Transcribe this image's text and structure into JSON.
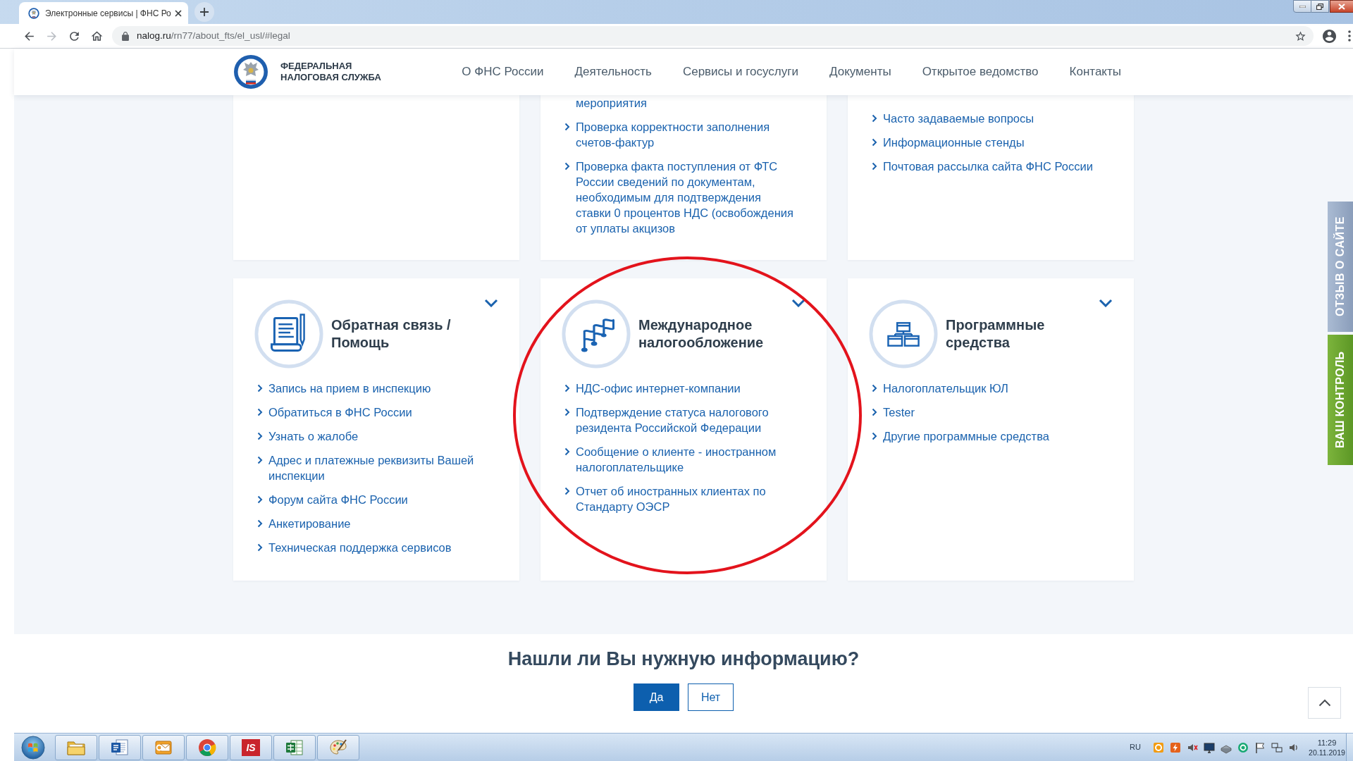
{
  "browser": {
    "tab_title": "Электронные сервисы | ФНС Ро",
    "nav_buttons": [
      {
        "kind": "back",
        "disabled": false
      },
      {
        "kind": "forward",
        "disabled": true
      },
      {
        "kind": "reload",
        "disabled": false
      },
      {
        "kind": "home",
        "disabled": false
      }
    ],
    "url": {
      "host": "nalog.ru",
      "path": "/rn77/about_fts/el_usl/#legal"
    }
  },
  "header": {
    "logo_lines": [
      "ФЕДЕРАЛЬНАЯ",
      "НАЛОГОВАЯ СЛУЖБА"
    ],
    "nav": [
      "О ФНС России",
      "Деятельность",
      "Сервисы и госуслуги",
      "Документы",
      "Открытое ведомство",
      "Контакты"
    ]
  },
  "top_cards": [
    {
      "items": [
        {
          "kind": "continuation",
          "text": "мероприятия"
        },
        {
          "kind": "link",
          "text": "Проверка корректности заполнения счетов-фактур"
        },
        {
          "kind": "link",
          "text": "Проверка факта поступления от ФТС России сведений по документам, необходимым для подтверждения ставки 0 процентов НДС (освобождения от уплаты акцизов"
        }
      ]
    },
    {
      "items": [
        {
          "kind": "link",
          "text": "Часто задаваемые вопросы"
        },
        {
          "kind": "link",
          "text": "Информационные стенды"
        },
        {
          "kind": "link",
          "text": "Почтовая рассылка сайта ФНС России"
        }
      ]
    }
  ],
  "cards": [
    {
      "kind": "feedback",
      "title": "Обратная связь / Помощь",
      "circled": false,
      "items": [
        "Запись на прием в инспекцию",
        "Обратиться в ФНС России",
        "Узнать о жалобе",
        "Адрес и платежные реквизиты Вашей инспекции",
        "Форум сайта ФНС России",
        "Анкетирование",
        "Техническая поддержка сервисов"
      ]
    },
    {
      "kind": "international",
      "title": "Международное налогообложение",
      "circled": true,
      "items": [
        "НДС-офис интернет-компании",
        "Подтверждение статуса налогового резидента Российской Федерации",
        "Сообщение о клиенте - иностранном налогоплательщике",
        "Отчет об иностранных клиентах по Стандарту ОЭСР"
      ]
    },
    {
      "kind": "software",
      "title": "Программные средства",
      "circled": false,
      "items": [
        "Налогоплательщик ЮЛ",
        "Tester",
        "Другие программные средства"
      ]
    }
  ],
  "side_tabs": [
    {
      "kind": "review",
      "label": "ОТЗЫВ О САЙТЕ"
    },
    {
      "kind": "control",
      "label": "ВАШ КОНТРОЛЬ"
    }
  ],
  "feedback": {
    "question": "Нашли ли Вы нужную информацию?",
    "buttons": [
      {
        "kind": "primary",
        "label": "Да"
      },
      {
        "kind": "secondary",
        "label": "Нет"
      }
    ]
  },
  "taskbar": {
    "apps": [
      {
        "kind": "folder"
      },
      {
        "kind": "document"
      },
      {
        "kind": "mail"
      },
      {
        "kind": "browser"
      },
      {
        "kind": "tile",
        "label": "IS"
      },
      {
        "kind": "spreadsheet"
      },
      {
        "kind": "palette"
      }
    ],
    "language": "RU",
    "time": "11:29",
    "date": "20.11.2019"
  }
}
